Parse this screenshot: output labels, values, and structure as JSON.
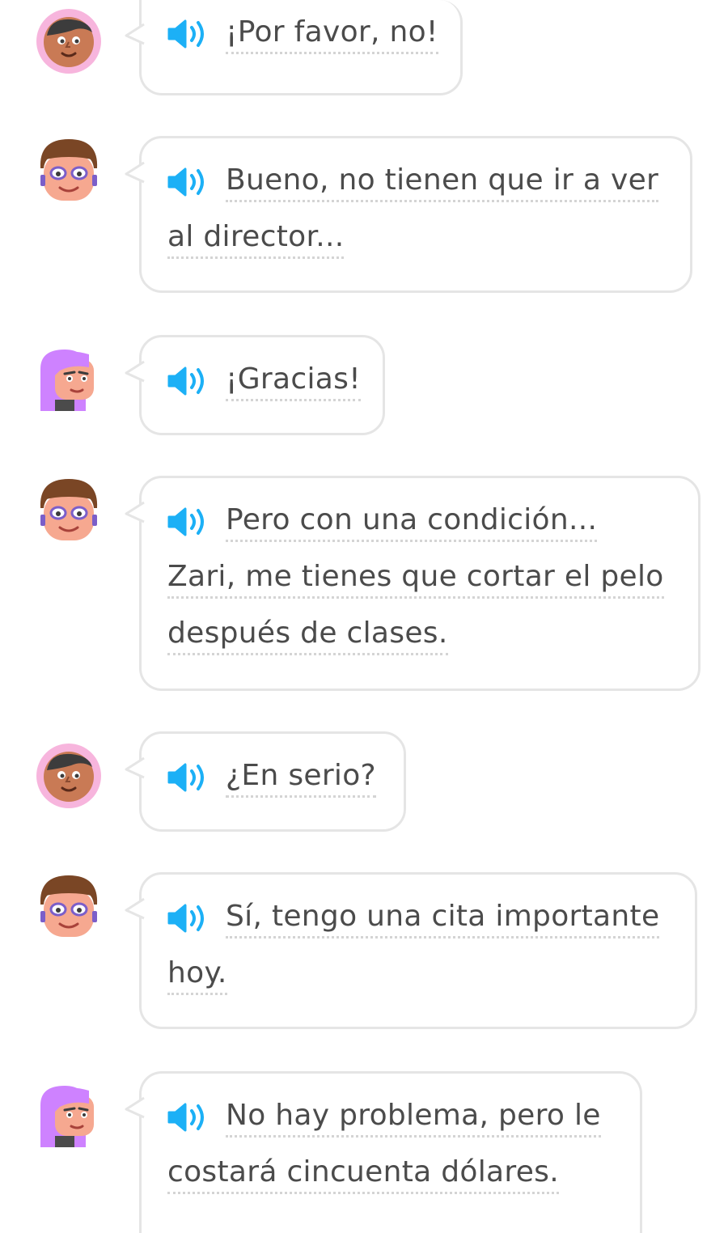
{
  "colors": {
    "bubble_border": "#e5e5e5",
    "text": "#4b4b4b",
    "speaker": "#1cb0f6",
    "dotted_underline": "#d4d4d4"
  },
  "messages": [
    {
      "speaker": "student-boy",
      "avatar_icon": "boy-avatar-icon",
      "lines": [
        "¡Por favor, no!"
      ]
    },
    {
      "speaker": "teacher",
      "avatar_icon": "teacher-avatar-icon",
      "lines": [
        "Bueno, no tienen que ir a ver",
        "al director..."
      ]
    },
    {
      "speaker": "zari",
      "avatar_icon": "zari-avatar-icon",
      "lines": [
        "¡Gracias!"
      ]
    },
    {
      "speaker": "teacher",
      "avatar_icon": "teacher-avatar-icon",
      "lines": [
        "Pero con una condición...",
        "Zari, me tienes que cortar el pelo",
        "después de clases."
      ]
    },
    {
      "speaker": "student-boy",
      "avatar_icon": "boy-avatar-icon",
      "lines": [
        "¿En serio?"
      ]
    },
    {
      "speaker": "teacher",
      "avatar_icon": "teacher-avatar-icon",
      "lines": [
        "Sí, tengo una cita importante",
        "hoy."
      ]
    },
    {
      "speaker": "zari",
      "avatar_icon": "zari-avatar-icon",
      "lines": [
        "No hay problema, pero le",
        "costará cincuenta dólares."
      ]
    }
  ]
}
